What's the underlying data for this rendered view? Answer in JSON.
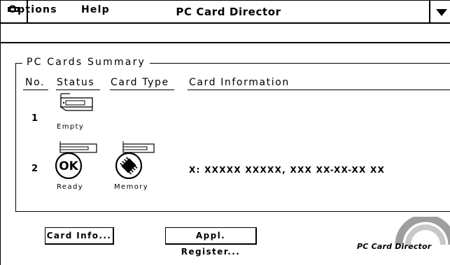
{
  "window": {
    "title": "PC Card Director"
  },
  "menu": {
    "options": "Options",
    "help": "Help"
  },
  "summary": {
    "group_title": "PC Cards Summary",
    "columns": {
      "no": "No.",
      "status": "Status",
      "card_type": "Card Type",
      "card_info": "Card Information"
    },
    "rows": [
      {
        "no": "1",
        "status": "Empty",
        "card_type": "",
        "info": ""
      },
      {
        "no": "2",
        "status": "Ready",
        "status_badge": "OK",
        "card_type": "Memory",
        "info": "X: XXXXX XXXXX, XXX XX-XX-XX XX"
      }
    ]
  },
  "buttons": {
    "card_info": "Card Info...",
    "appl_register": "Appl. Register..."
  },
  "logo": {
    "text": "PC Card Director"
  },
  "icons": {
    "system_menu": "system-menu-icon",
    "minimize": "minimize-arrow-icon",
    "empty_slot": "empty-slot-icon",
    "ok_status": "ok-status-icon",
    "memory_card": "memory-card-icon",
    "logo_arc": "logo-arc-icon"
  }
}
